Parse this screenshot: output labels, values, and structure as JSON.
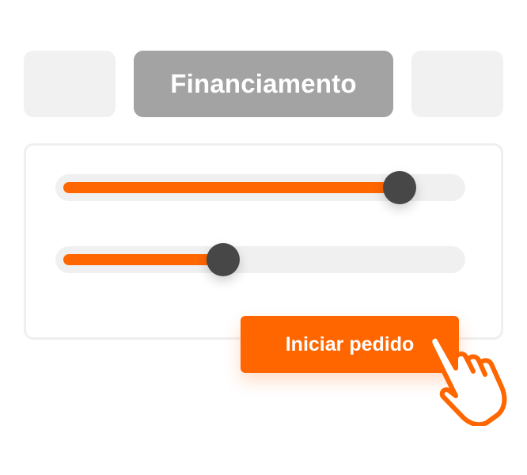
{
  "tabs": [
    {
      "label": "",
      "active": false
    },
    {
      "label": "Financiamento",
      "active": true
    },
    {
      "label": "",
      "active": false
    }
  ],
  "sliders": [
    {
      "value": 0.84
    },
    {
      "value": 0.41
    }
  ],
  "cta": {
    "label": "Iniciar pedido"
  },
  "colors": {
    "accent": "#ff6600",
    "tab_active": "#a3a3a3",
    "tab_inactive": "#f1f1f1",
    "thumb": "#474747",
    "track": "#f0f0f0"
  },
  "icons": {
    "cursor": "pointing-hand-icon"
  }
}
